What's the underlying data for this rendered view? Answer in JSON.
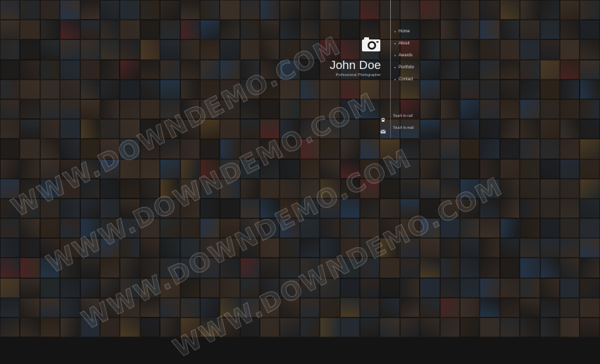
{
  "brand": {
    "name": "John Doe",
    "tagline": "Professional Photographer"
  },
  "nav": {
    "items": [
      {
        "label": "Home"
      },
      {
        "label": "About"
      },
      {
        "label": "Awards"
      },
      {
        "label": "Portfolio"
      },
      {
        "label": "Contact"
      }
    ]
  },
  "contact": {
    "phone_label": "Touch to call",
    "email_label": "Touch to mail"
  },
  "watermark": {
    "text": "WWW.DOWNDEMO.COM"
  },
  "icons": {
    "logo": "camera-icon",
    "phone": "phone-icon",
    "email": "envelope-icon"
  }
}
